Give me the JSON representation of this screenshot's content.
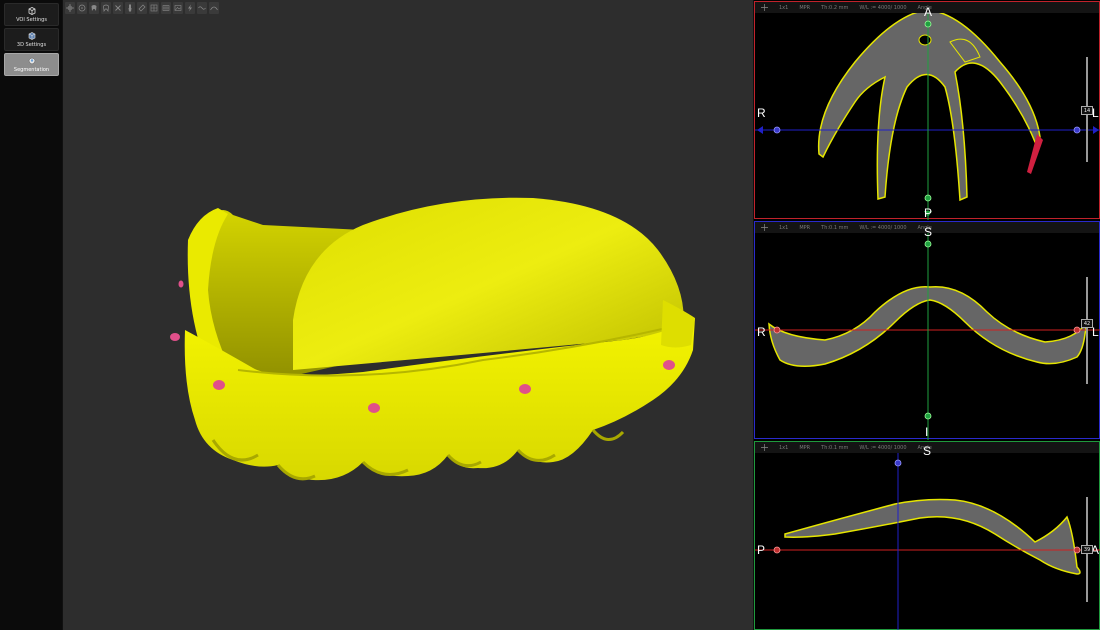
{
  "sidebar": {
    "items": [
      {
        "label": "VOI Settings",
        "icon": "voi-cube-icon",
        "active": false
      },
      {
        "label": "3D Settings",
        "icon": "3d-cube-icon",
        "active": false
      },
      {
        "label": "Segmentation",
        "icon": "segmentation-icon",
        "active": true
      }
    ]
  },
  "toolbar3d": {
    "buttons": [
      "crosshair-icon",
      "radiation-icon",
      "tooth-icon",
      "tooth-outline-icon",
      "close-icon",
      "brush-icon",
      "eraser-icon",
      "grid-icon",
      "mesh-icon",
      "image-icon",
      "lightning-icon",
      "wave-icon",
      "curve-icon"
    ]
  },
  "model": {
    "color": "#e6e600",
    "marker_color": "#e0508a"
  },
  "mpr": {
    "header": {
      "layout": "1x1",
      "mode": "MPR",
      "wl": "W/L := 4000/ 1000",
      "angle": "Angle"
    },
    "axial": {
      "thickness": "Th:0.2 mm",
      "top": "A",
      "bottom": "P",
      "left": "R",
      "right": "L",
      "slider_value": "14",
      "border_color": "#c0222b"
    },
    "coronal": {
      "thickness": "Th:0.1 mm",
      "top": "S",
      "bottom": "I",
      "left": "R",
      "right": "L",
      "slider_value": "42",
      "border_color": "#2a2acc"
    },
    "sagittal": {
      "thickness": "Th:0.1 mm",
      "top": "S",
      "left": "P",
      "right": "A",
      "slider_value": "39",
      "border_color": "#1f9a3d"
    }
  },
  "colors": {
    "viewport_bg": "#2d2d2d",
    "contour": "#e6e600",
    "fill": "#6f6f6f",
    "crosshair_red": "#d02020",
    "crosshair_blue": "#2020c8",
    "crosshair_green": "#20a040"
  }
}
